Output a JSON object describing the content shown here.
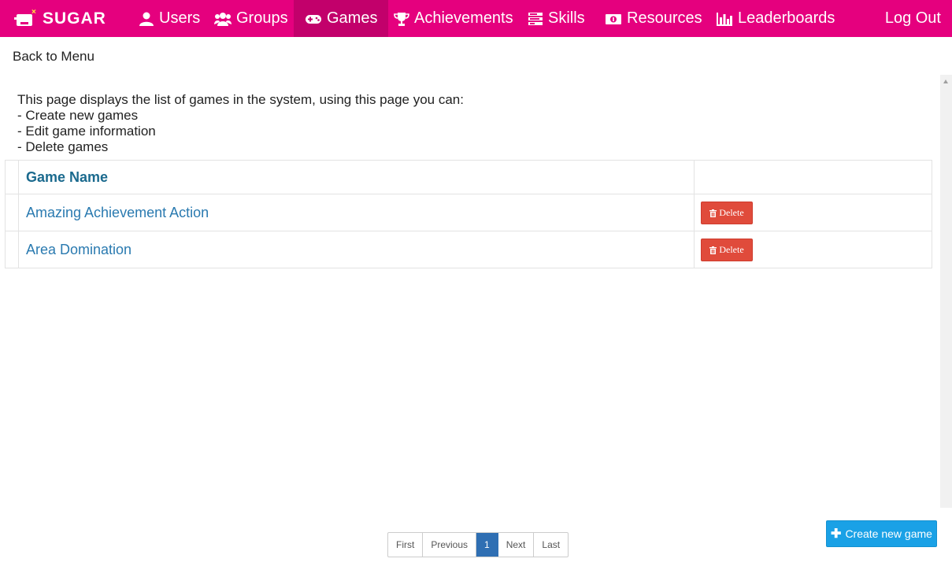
{
  "brand": {
    "name": "SUGAR",
    "logo_icon": "sugar-logo-icon"
  },
  "nav": {
    "items": [
      {
        "label": "Users",
        "icon": "user-icon"
      },
      {
        "label": "Groups",
        "icon": "users-group-icon"
      },
      {
        "label": "Games",
        "icon": "gamepad-icon"
      },
      {
        "label": "Achievements",
        "icon": "trophy-icon"
      },
      {
        "label": "Skills",
        "icon": "tasks-icon"
      },
      {
        "label": "Resources",
        "icon": "money-icon"
      },
      {
        "label": "Leaderboards",
        "icon": "bar-chart-icon"
      }
    ],
    "active": "Games",
    "logout_label": "Log Out"
  },
  "back_label": "Back to Menu",
  "description": {
    "intro": "This page displays the list of games in the system, using this page you can:",
    "bullets": [
      "- Create new games",
      "- Edit game information",
      "- Delete games"
    ]
  },
  "table": {
    "header": "Game Name",
    "rows": [
      {
        "name": "Amazing Achievement Action",
        "action_label": "Delete"
      },
      {
        "name": "Area Domination",
        "action_label": "Delete"
      }
    ]
  },
  "pagination": {
    "first": "First",
    "previous": "Previous",
    "current": "1",
    "next": "Next",
    "last": "Last"
  },
  "create_button": {
    "label": "Create new game"
  },
  "colors": {
    "nav_bg": "#e5007e",
    "nav_active": "#c2006b",
    "link": "#2a7ab0",
    "delete": "#e04b3b",
    "primary": "#1aa1e6",
    "page_active": "#2f6fb3"
  }
}
